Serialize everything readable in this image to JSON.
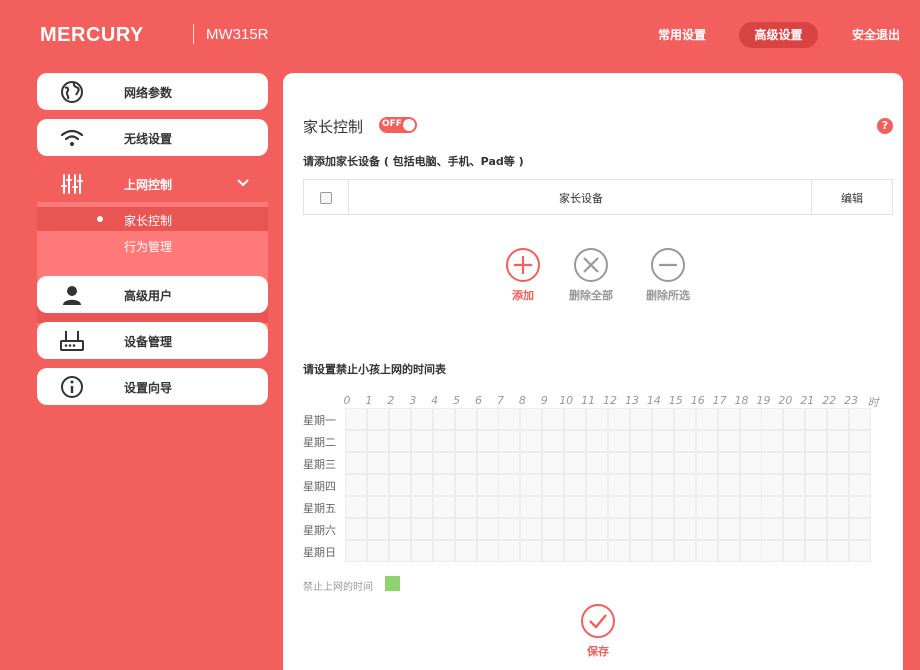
{
  "header": {
    "brand": "MERCURY",
    "model": "MW315R",
    "nav": [
      {
        "label": "常用设置",
        "active": false
      },
      {
        "label": "高级设置",
        "active": true
      },
      {
        "label": "安全退出",
        "active": false
      }
    ]
  },
  "sidebar": {
    "items": [
      {
        "label": "网络参数",
        "icon": "globe-icon"
      },
      {
        "label": "无线设置",
        "icon": "wifi-icon"
      },
      {
        "label": "上网控制",
        "icon": "sliders-icon",
        "expanded": true,
        "children": [
          {
            "label": "家长控制",
            "active": true
          },
          {
            "label": "行为管理",
            "active": false
          }
        ]
      },
      {
        "label": "高级用户",
        "icon": "user-icon"
      },
      {
        "label": "设备管理",
        "icon": "router-icon"
      },
      {
        "label": "设置向导",
        "icon": "info-icon"
      }
    ]
  },
  "main": {
    "title": "家长控制",
    "toggle_label": "OFF",
    "help_label": "?",
    "device_section_label": "请添加家长设备 ( 包括电脑、手机、Pad等 )",
    "table_headers": [
      "家长设备",
      "编辑"
    ],
    "actions": [
      {
        "label": "添加",
        "icon": "plus-icon",
        "color": "#f25f5c"
      },
      {
        "label": "删除全部",
        "icon": "x-icon",
        "color": "#999999"
      },
      {
        "label": "删除所选",
        "icon": "minus-icon",
        "color": "#999999"
      }
    ],
    "schedule_label": "请设置禁止小孩上网的时间表",
    "hours": [
      "0",
      "1",
      "2",
      "3",
      "4",
      "5",
      "6",
      "7",
      "8",
      "9",
      "10",
      "11",
      "12",
      "13",
      "14",
      "15",
      "16",
      "17",
      "18",
      "19",
      "20",
      "21",
      "22",
      "23",
      "时"
    ],
    "days": [
      "星期一",
      "星期二",
      "星期三",
      "星期四",
      "星期五",
      "星期六",
      "星期日"
    ],
    "legend_label": "禁止上网的时间",
    "legend_color": "#8fd36c",
    "save_label": "保存"
  },
  "colors": {
    "accent": "#f25f5c",
    "accent_dark": "#d94442",
    "submenu": "#ff7a78"
  }
}
